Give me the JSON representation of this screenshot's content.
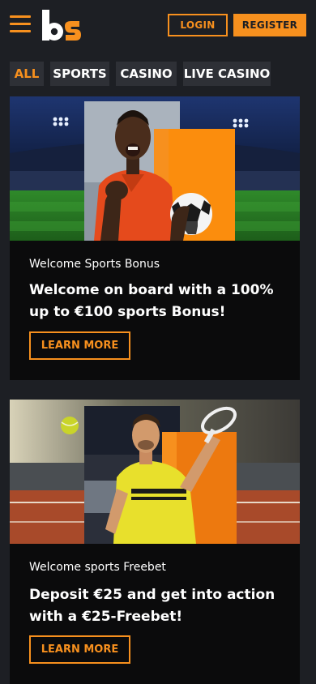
{
  "header": {
    "logo_text": "bs",
    "login_label": "LOGIN",
    "register_label": "REGISTER"
  },
  "tabs": [
    {
      "label": "ALL",
      "active": true
    },
    {
      "label": "SPORTS",
      "active": false
    },
    {
      "label": "CASINO",
      "active": false
    },
    {
      "label": "LIVE CASINO",
      "active": false
    }
  ],
  "promotions": [
    {
      "subtitle": "Welcome Sports Bonus",
      "title": "Welcome on board with a 100% up to €100 sports Bonus!",
      "button_label": "LEARN MORE"
    },
    {
      "subtitle": "Welcome sports Freebet",
      "title": "Deposit €25 and get into action with a €25-Freebet!",
      "button_label": "LEARN MORE"
    }
  ],
  "colors": {
    "accent": "#f7901e",
    "background": "#1d1f24",
    "card": "#0b0b0c",
    "tab": "#2e3036"
  },
  "icons": [
    "hamburger-menu-icon",
    "bs-logo"
  ]
}
